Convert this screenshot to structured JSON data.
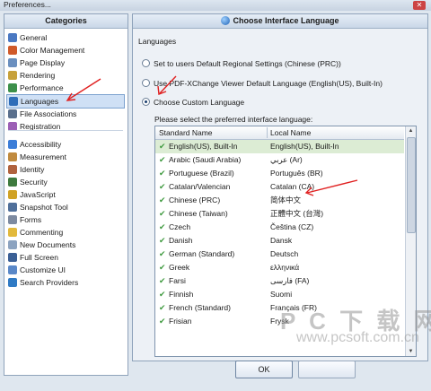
{
  "window": {
    "title": "Preferences...",
    "close_glyph": "✕"
  },
  "categories": {
    "header": "Categories",
    "items": [
      {
        "label": "General",
        "icon": "general-icon",
        "color": "#4a78c2"
      },
      {
        "label": "Color Management",
        "icon": "color-management-icon",
        "color": "#d05a2a"
      },
      {
        "label": "Page Display",
        "icon": "page-display-icon",
        "color": "#6a8fbf"
      },
      {
        "label": "Rendering",
        "icon": "rendering-icon",
        "color": "#c7a13a"
      },
      {
        "label": "Performance",
        "icon": "performance-icon",
        "color": "#3c8f4a"
      },
      {
        "label": "Languages",
        "icon": "globe-icon",
        "color": "#2f6db8",
        "selected": true
      },
      {
        "label": "File Associations",
        "icon": "file-associations-icon",
        "color": "#5a6f8c"
      },
      {
        "label": "Registration",
        "icon": "registration-icon",
        "color": "#9c5fb5"
      },
      {
        "label": "Accessibility",
        "icon": "accessibility-icon",
        "color": "#3b7dd8"
      },
      {
        "label": "Measurement",
        "icon": "measurement-icon",
        "color": "#c08a3e"
      },
      {
        "label": "Identity",
        "icon": "identity-icon",
        "color": "#b0623e"
      },
      {
        "label": "Security",
        "icon": "security-icon",
        "color": "#3e7a3e"
      },
      {
        "label": "JavaScript",
        "icon": "javascript-icon",
        "color": "#d0a224"
      },
      {
        "label": "Snapshot Tool",
        "icon": "snapshot-icon",
        "color": "#4f6f9a"
      },
      {
        "label": "Forms",
        "icon": "forms-icon",
        "color": "#7d8aa0"
      },
      {
        "label": "Commenting",
        "icon": "commenting-icon",
        "color": "#e2b93b"
      },
      {
        "label": "New Documents",
        "icon": "new-documents-icon",
        "color": "#8ca3c0"
      },
      {
        "label": "Full Screen",
        "icon": "full-screen-icon",
        "color": "#3a5f95"
      },
      {
        "label": "Customize UI",
        "icon": "customize-ui-icon",
        "color": "#5a88c8"
      },
      {
        "label": "Search Providers",
        "icon": "search-providers-icon",
        "color": "#2f7ac4"
      }
    ]
  },
  "panel": {
    "title": "Choose Interface Language",
    "group_label": "Languages",
    "options": [
      {
        "label": "Set to users Default Regional Settings (Chinese (PRC))",
        "selected": false
      },
      {
        "label": "Use PDF-XChange Viewer Default Language (English(US), Built-In)",
        "selected": false
      },
      {
        "label": "Choose Custom Language",
        "selected": true
      }
    ],
    "hint": "Please select the preferred interface language:",
    "columns": {
      "standard": "Standard Name",
      "local": "Local Name"
    },
    "check_glyph": "✔",
    "languages": [
      {
        "standard": "English(US), Built-In",
        "local": "English(US), Built-In",
        "selected": true
      },
      {
        "standard": "Arabic (Saudi Arabia)",
        "local": "عربي (Ar)"
      },
      {
        "standard": "Portuguese (Brazil)",
        "local": "Português (BR)"
      },
      {
        "standard": "Catalan/Valencian",
        "local": "Catalan (CA)"
      },
      {
        "standard": "Chinese (PRC)",
        "local": "简体中文"
      },
      {
        "standard": "Chinese (Taiwan)",
        "local": "正體中文 (台灣)"
      },
      {
        "standard": "Czech",
        "local": "Čeština (CZ)"
      },
      {
        "standard": "Danish",
        "local": "Dansk"
      },
      {
        "standard": "German (Standard)",
        "local": "Deutsch"
      },
      {
        "standard": "Greek",
        "local": "ελληνικά"
      },
      {
        "standard": "Farsi",
        "local": "فارسی (FA)"
      },
      {
        "standard": "Finnish",
        "local": "Suomi"
      },
      {
        "standard": "French (Standard)",
        "local": "Français (FR)"
      },
      {
        "standard": "Frisian",
        "local": "Frysk"
      }
    ]
  },
  "buttons": {
    "ok": "OK"
  },
  "watermark": {
    "line1": "P C 下 载 网",
    "line2": "www.pcsoft.com.cn"
  },
  "annotation_color": "#e02020"
}
